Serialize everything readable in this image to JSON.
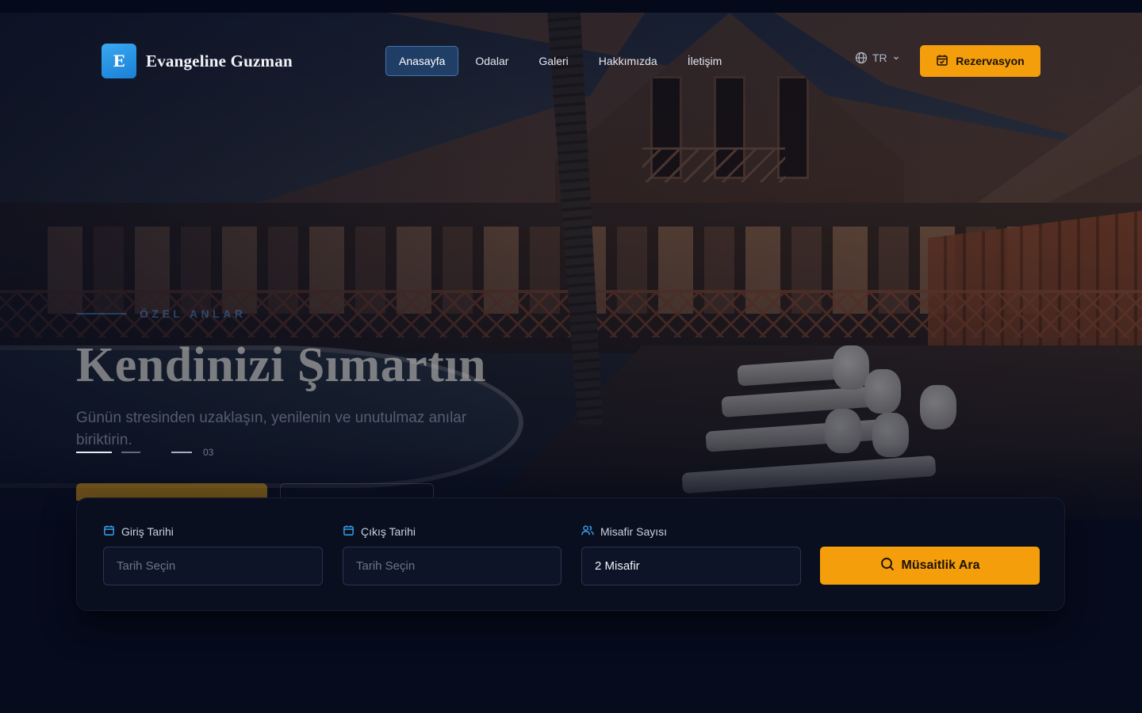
{
  "brand": {
    "logo_letter": "E",
    "name": "Evangeline Guzman",
    "logo_color": "#2196f3"
  },
  "nav": {
    "items": [
      {
        "label": "Anasayfa",
        "active": true
      },
      {
        "label": "Odalar",
        "active": false
      },
      {
        "label": "Galeri",
        "active": false
      },
      {
        "label": "Hakkımızda",
        "active": false
      },
      {
        "label": "İletişim",
        "active": false
      }
    ],
    "language": {
      "label": "TR",
      "icon": "globe-icon"
    },
    "reserve_button": {
      "label": "Rezervasyon",
      "icon": "calendar-check-icon"
    }
  },
  "hero": {
    "eyebrow": "ÖZEL ANLAR",
    "title": "Kendinizi Şımartın",
    "subtitle": "Günün stresinden uzaklaşın, yenilenin ve unutulmaz anılar biriktirin.",
    "slider": {
      "current": 1,
      "total_label": "03",
      "slide_count": 3
    }
  },
  "booking": {
    "checkin": {
      "label": "Giriş Tarihi",
      "placeholder": "Tarih Seçin",
      "icon": "calendar-icon"
    },
    "checkout": {
      "label": "Çıkış Tarihi",
      "placeholder": "Tarih Seçin",
      "icon": "calendar-icon"
    },
    "guests": {
      "label": "Misafir Sayısı",
      "value": "2 Misafir",
      "icon": "users-icon"
    },
    "search_button": {
      "label": "Müsaitlik Ara",
      "icon": "search-icon"
    }
  },
  "colors": {
    "accent": "#f59e0b",
    "primary": "#2196f3",
    "background": "#060b1d",
    "panel": "#0a0f1f"
  }
}
